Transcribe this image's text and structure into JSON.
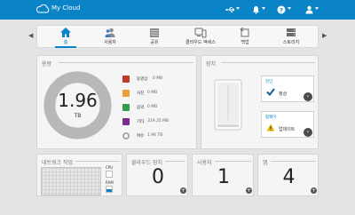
{
  "app": {
    "title": "My Cloud"
  },
  "header": {
    "usb_icon": "usb-icon",
    "bell_icon": "bell-icon",
    "help_icon": "help-icon",
    "user_icon": "user-icon"
  },
  "nav": {
    "items": [
      {
        "label": "홈",
        "icon": "home-icon",
        "active": true
      },
      {
        "label": "사용자",
        "icon": "users-icon"
      },
      {
        "label": "공유",
        "icon": "folder-icon"
      },
      {
        "label": "클라우드 액세스",
        "icon": "cloud-devices-icon"
      },
      {
        "label": "백업",
        "icon": "backup-icon"
      },
      {
        "label": "스토리지",
        "icon": "storage-icon"
      }
    ]
  },
  "storage": {
    "title": "용량",
    "total_value": "1.96",
    "total_unit": "TB",
    "legend": [
      {
        "label": "동영상",
        "value": "0 MB",
        "color": "#c0392b"
      },
      {
        "label": "사진",
        "value": "0 MB",
        "color": "#e8a13a"
      },
      {
        "label": "음악",
        "value": "0 MB",
        "color": "#2e9e4a"
      },
      {
        "label": "기타",
        "value": "319.35 MB",
        "color": "#7a2b8f"
      },
      {
        "label": "여유",
        "value": "1.96 TB",
        "color": "#aaaaaa"
      }
    ]
  },
  "device": {
    "title": "장치",
    "diagnostics_label": "진단",
    "diagnostics_status": "정상",
    "firmware_label": "펌웨어",
    "firmware_status": "업데이트"
  },
  "network": {
    "title": "네트워크 작업",
    "cpu_label": "CPU",
    "ram_label": "RAM"
  },
  "cloud_devices": {
    "title": "클라우드 장치",
    "count": "0"
  },
  "users": {
    "title": "사용자",
    "count": "1"
  },
  "apps": {
    "title": "앱",
    "count": "4"
  }
}
